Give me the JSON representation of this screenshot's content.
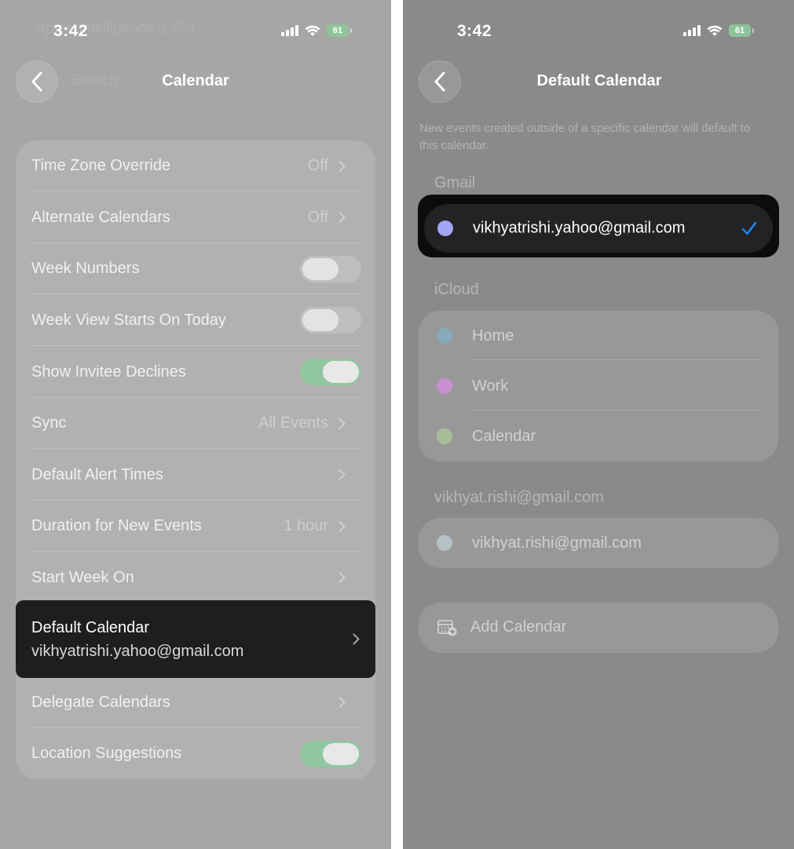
{
  "left": {
    "status": {
      "time": "3:42",
      "battery": "61"
    },
    "ghost_header": "Apple Intelligence & Siri",
    "ghost_search": "Search",
    "title": "Calendar",
    "rows": [
      {
        "label": "Time Zone Override",
        "value": "Off"
      },
      {
        "label": "Alternate Calendars",
        "value": "Off"
      },
      {
        "label": "Week Numbers",
        "toggle": "off"
      },
      {
        "label": "Week View Starts On Today",
        "toggle": "off"
      },
      {
        "label": "Show Invitee Declines",
        "toggle": "on"
      },
      {
        "label": "Sync",
        "value": "All Events"
      },
      {
        "label": "Default Alert Times",
        "value": ""
      },
      {
        "label": "Duration for New Events",
        "value": "1 hour"
      },
      {
        "label": "Start Week On",
        "value": ""
      }
    ],
    "default_calendar": {
      "label": "Default Calendar",
      "value": "vikhyatrishi.yahoo@gmail.com"
    },
    "rows_after": [
      {
        "label": "Delegate Calendars"
      },
      {
        "label": "Location Suggestions",
        "toggle": "on"
      }
    ]
  },
  "right": {
    "status": {
      "time": "3:42",
      "battery": "61"
    },
    "title": "Default Calendar",
    "description": "New events created outside of a specific calendar will default to this calendar.",
    "gmail_header": "Gmail",
    "gmail_selected": {
      "label": "vikhyatrishi.yahoo@gmail.com",
      "color": "#a3a4f5"
    },
    "icloud_header": "iCloud",
    "icloud_items": [
      {
        "label": "Home",
        "color": "#86a9bb"
      },
      {
        "label": "Work",
        "color": "#c98fd0"
      },
      {
        "label": "Calendar",
        "color": "#a7bf99"
      }
    ],
    "account_header": "vikhyat.rishi@gmail.com",
    "account_item": {
      "label": "vikhyat.rishi@gmail.com",
      "color": "#b5c1c4"
    },
    "add_calendar": "Add Calendar"
  },
  "colors": {
    "check": "#1e8cf5",
    "toggle_on": "#91c7a1"
  }
}
